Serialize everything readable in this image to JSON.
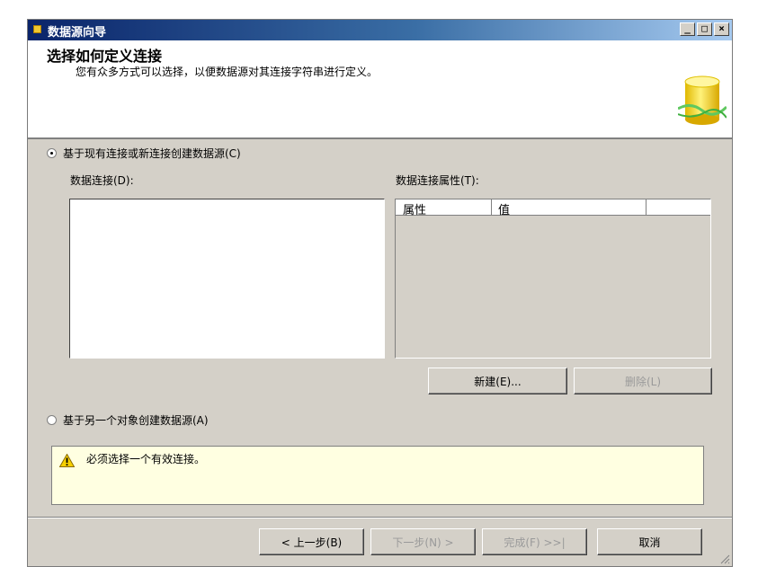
{
  "window": {
    "title": "数据源向导",
    "minimize_glyph": "_",
    "maximize_glyph": "□",
    "close_glyph": "×"
  },
  "header": {
    "title": "选择如何定义连接",
    "subtitle": "您有众多方式可以选择，以便数据源对其连接字符串进行定义。",
    "icon": "database-cylinder-icon"
  },
  "option_existing": {
    "label": "基于现有连接或新连接创建数据源(C)",
    "selected": true
  },
  "data_connections": {
    "label": "数据连接(D):"
  },
  "connection_properties": {
    "label": "数据连接属性(T):",
    "columns": [
      "属性",
      "值"
    ]
  },
  "buttons": {
    "new": "新建(E)...",
    "delete": "删除(L)"
  },
  "option_other": {
    "label": "基于另一个对象创建数据源(A)",
    "selected": false
  },
  "warning": {
    "icon": "warning-icon",
    "text": "必须选择一个有效连接。"
  },
  "footer": {
    "back": "< 上一步(B)",
    "next": "下一步(N) >",
    "finish": "完成(F) >>|",
    "cancel": "取消"
  },
  "colors": {
    "title_bar": "#0a246a",
    "dialog_bg": "#d4d0c8",
    "warning_bg": "#ffffe1"
  }
}
